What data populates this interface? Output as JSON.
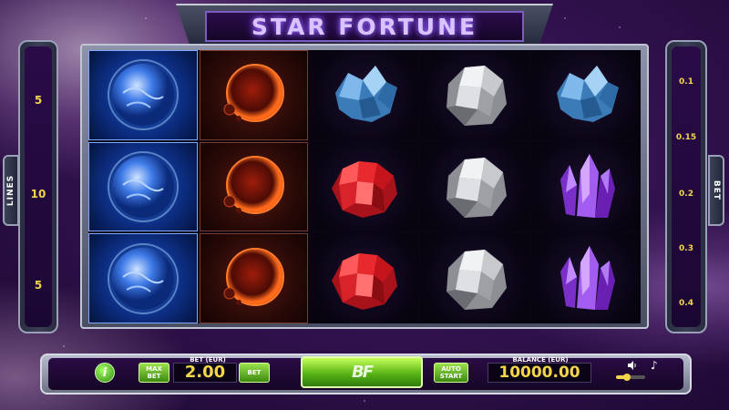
{
  "title": "STAR FORTUNE",
  "lines": {
    "tab_label": "LINES",
    "values": [
      "5",
      "10",
      "5"
    ]
  },
  "bet_panel": {
    "tab_label": "BET",
    "values": [
      "0.1",
      "0.15",
      "0.2",
      "0.3",
      "0.4"
    ]
  },
  "reels": [
    [
      "blue-planet",
      "red-planet",
      "blue-crystal",
      "silver-rock",
      "blue-crystal"
    ],
    [
      "blue-planet",
      "red-planet",
      "red-gem",
      "silver-rock",
      "purple-crystal"
    ],
    [
      "blue-planet",
      "red-planet",
      "red-gem",
      "silver-rock",
      "purple-crystal"
    ]
  ],
  "controls": {
    "info_label": "i",
    "max_bet_label": "MAX BET",
    "bet_label": "BET (EUR)",
    "bet_value": "2.00",
    "bet_button_label": "BET",
    "spin_logo": "BF",
    "autostart_label": "AUTO START",
    "balance_label": "BALANCE (EUR)",
    "balance_value": "10000.00",
    "sound_icon": "speaker-icon",
    "music_icon": "music-note-icon"
  },
  "colors": {
    "accent_yellow": "#f3d54b",
    "button_green": "#58b515",
    "title_purple": "#d9c4ff"
  }
}
